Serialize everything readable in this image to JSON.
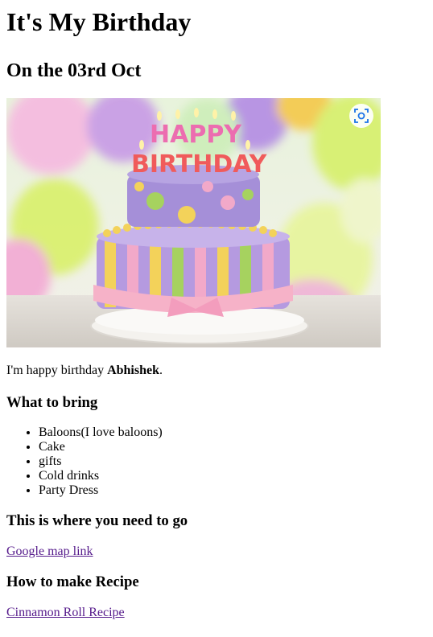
{
  "page": {
    "title": "It's My Birthday",
    "date_heading": "On the 03rd Oct"
  },
  "hero": {
    "cake_text_top": "HAPPY",
    "cake_text_bottom": "BIRTHDAY",
    "lens_icon": "visual-search-icon",
    "colors": {
      "cake_top": "#a58fd8",
      "cake_bottom": "#b59ae0",
      "stripe_pink": "#f2a9c9",
      "stripe_yellow": "#f3d25a",
      "stripe_green": "#a6d25f",
      "ribbon": "#f6b2c8",
      "plate": "#f4f2ee"
    }
  },
  "intro": {
    "prefix": "I'm happy birthday ",
    "name": "Abhishek",
    "suffix": "."
  },
  "bring": {
    "heading": "What to bring",
    "items": [
      "Baloons(I love baloons)",
      "Cake",
      "gifts",
      "Cold drinks",
      "Party Dress"
    ]
  },
  "location": {
    "heading": "This is where you need to go",
    "link_text": "Google map link"
  },
  "recipe": {
    "heading": "How to make Recipe",
    "link_text": "Cinnamon Roll Recipe"
  },
  "link_color": "#551a8b"
}
